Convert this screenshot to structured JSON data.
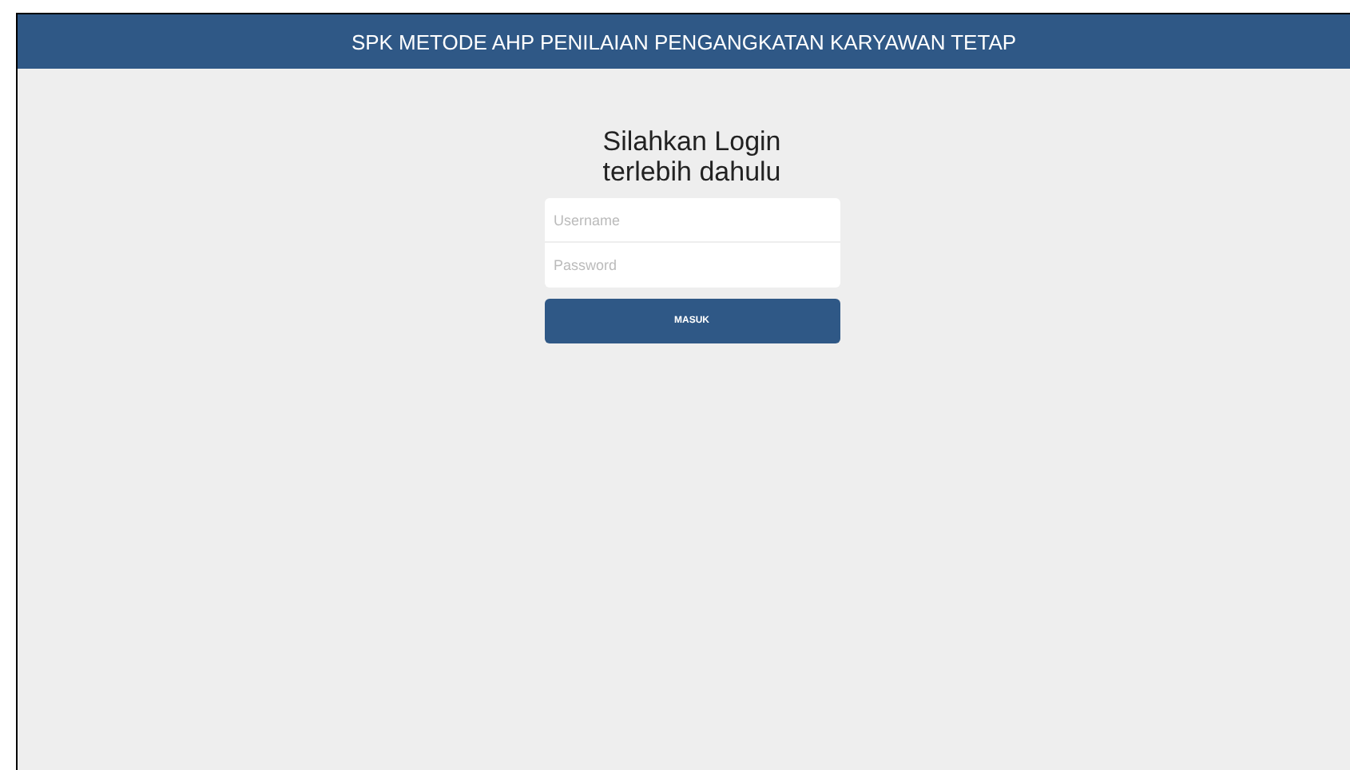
{
  "header": {
    "title": "SPK METODE AHP PENILAIAN PENGANGKATAN KARYAWAN TETAP"
  },
  "login": {
    "heading_lines": [
      "Silahkan Login",
      "terlebih dahulu"
    ],
    "fields": [
      {
        "placeholder": "Username"
      },
      {
        "placeholder": "Password"
      }
    ],
    "button": "MASUK"
  }
}
